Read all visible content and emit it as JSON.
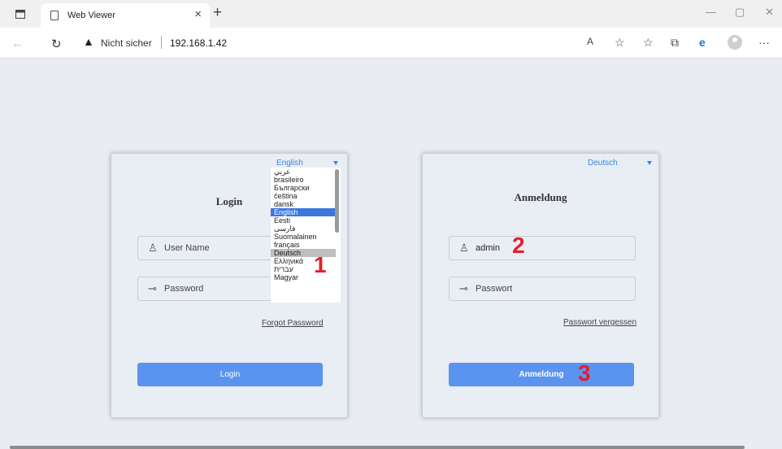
{
  "browser": {
    "tab_title": "Web Viewer",
    "tab_close": "×",
    "new_tab": "+",
    "not_secure": "Nicht sicher",
    "url": "192.168.1.42",
    "read_aloud": "A",
    "more": "···"
  },
  "panel_en": {
    "language": "English",
    "title": "Login",
    "username_placeholder": "User Name",
    "password_placeholder": "Password",
    "forgot": "Forgot Password",
    "login_button": "Login",
    "language_options": [
      "عربي",
      "brasileiro",
      "Български",
      "čeština",
      "dansk",
      "English",
      "Eesti",
      "فارسی",
      "Suomalainen",
      "français",
      "Deutsch",
      "Ελληνικά",
      "עברית",
      "Magyar"
    ],
    "selected_option": "English",
    "hovered_option": "Deutsch"
  },
  "panel_de": {
    "language": "Deutsch",
    "title": "Anmeldung",
    "username_value": "admin",
    "password_placeholder": "Passwort",
    "forgot": "Passwort vergessen",
    "login_button": "Anmeldung"
  },
  "steps": [
    "1",
    "2",
    "3"
  ],
  "colors": {
    "accent": "#5b94f0",
    "step_marker": "#e0202a",
    "page_bg": "#e9edf3"
  }
}
